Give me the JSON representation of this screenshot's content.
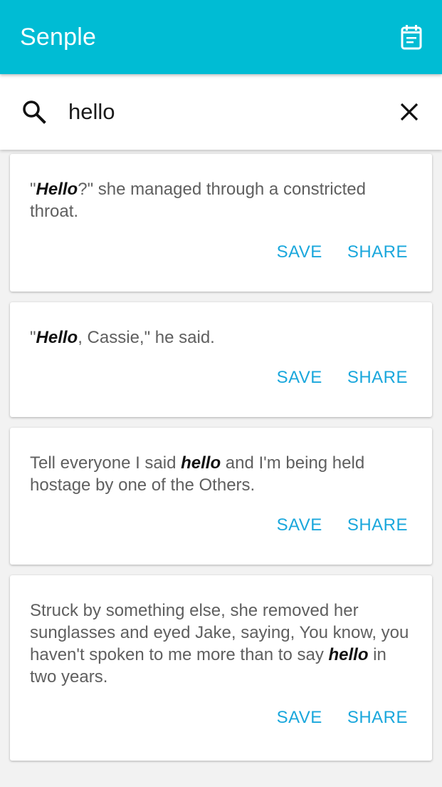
{
  "app_bar": {
    "title": "Senple",
    "calendar_icon": "calendar-note-icon",
    "background": "#00bcd4"
  },
  "search": {
    "icon": "search-icon",
    "value": "hello",
    "clear_icon": "close-icon"
  },
  "results": [
    {
      "segments": [
        {
          "text": "\"",
          "bold": false
        },
        {
          "text": "Hello",
          "bold": true
        },
        {
          "text": "?\" she managed through a constricted throat.",
          "bold": false
        }
      ],
      "save_label": "SAVE",
      "share_label": "SHARE"
    },
    {
      "segments": [
        {
          "text": "\"",
          "bold": false
        },
        {
          "text": "Hello",
          "bold": true
        },
        {
          "text": ", Cassie,\" he said.",
          "bold": false
        }
      ],
      "save_label": "SAVE",
      "share_label": "SHARE"
    },
    {
      "segments": [
        {
          "text": "Tell everyone I said ",
          "bold": false
        },
        {
          "text": "hello",
          "bold": true
        },
        {
          "text": " and I'm being held hostage by one of the Others.",
          "bold": false
        }
      ],
      "save_label": "SAVE",
      "share_label": "SHARE"
    },
    {
      "segments": [
        {
          "text": "Struck by something else, she removed her sunglasses and eyed Jake, saying, You know, you haven't spoken to me more than to say ",
          "bold": false
        },
        {
          "text": "hello",
          "bold": true
        },
        {
          "text": " in two years.",
          "bold": false
        }
      ],
      "save_label": "SAVE",
      "share_label": "SHARE"
    }
  ],
  "colors": {
    "accent": "#1aa7dc",
    "text": "#5f5f5f",
    "highlight": "#111111"
  }
}
